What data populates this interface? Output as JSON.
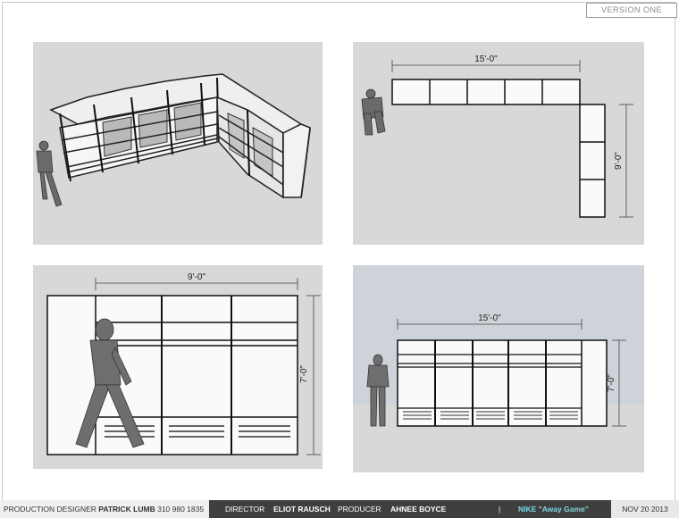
{
  "version_label": "VERSION ONE",
  "views": {
    "perspective": {
      "name": "perspective-view"
    },
    "plan": {
      "width_dim": "15'-0\"",
      "depth_dim": "9'-0\""
    },
    "side_elevation": {
      "width_dim": "9'-0\"",
      "height_dim": "7'-0\""
    },
    "front_elevation": {
      "width_dim": "15'-0\"",
      "height_dim": "7'-0\""
    }
  },
  "footer": {
    "designer_role": "PRODUCTION DESIGNER",
    "designer_name": "PATRICK LUMB",
    "designer_phone": "310 980 1835",
    "director_role": "DIRECTOR",
    "director_name": "ELIOT RAUSCH",
    "producer_role": "PRODUCER",
    "producer_name": "AHNEE  BOYCE",
    "separator": "|",
    "project": "NIKE \"Away Game\"",
    "date": "NOV 20 2013"
  },
  "colors": {
    "panel_bg_gray": "#d8d8d6",
    "panel_bg_blue": "#cdd3d8",
    "footer_dark": "#3f3f3f",
    "project_accent": "#7fd6e0"
  }
}
